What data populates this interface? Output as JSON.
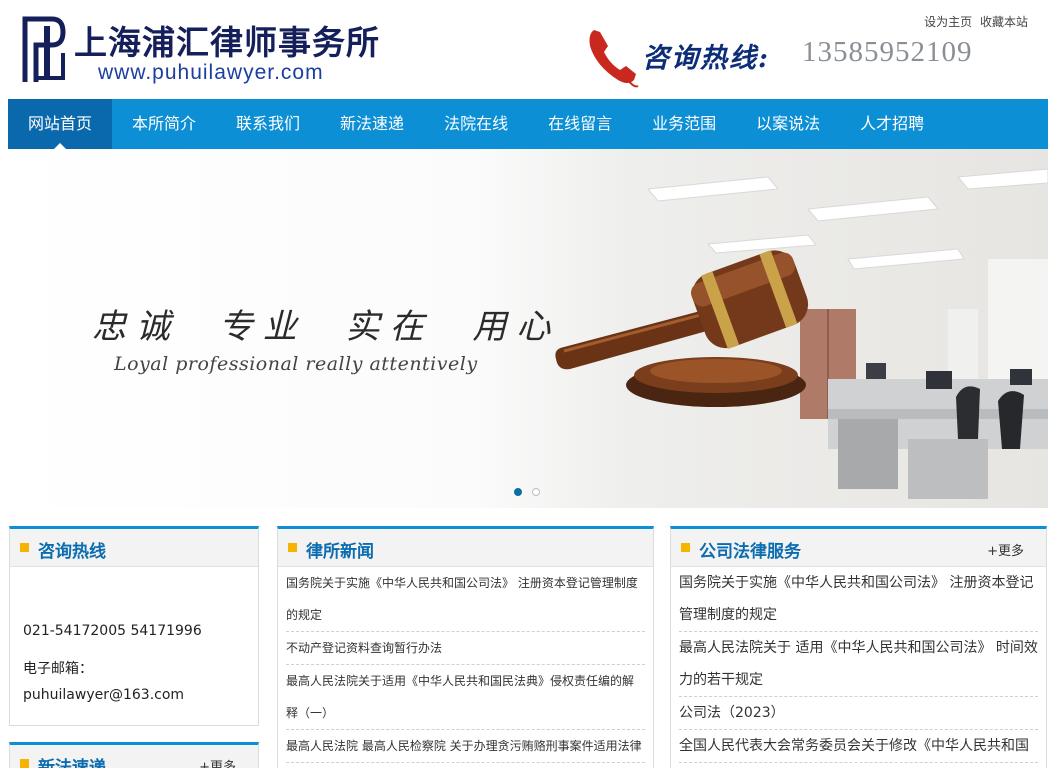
{
  "header": {
    "site_name": "上海浦汇律师事务所",
    "site_url": "www.puhuilawyer.com",
    "top_links": [
      "设为主页",
      "收藏本站"
    ],
    "hotline_label": "咨询热线:",
    "hotline_number": "13585952109"
  },
  "nav": {
    "items": [
      "网站首页",
      "本所简介",
      "联系我们",
      "新法速递",
      "法院在线",
      "在线留言",
      "业务范围",
      "以案说法",
      "人才招聘"
    ],
    "active_index": 0
  },
  "banner": {
    "slogan_cn": "忠诚 专业 实在 用心",
    "slogan_en": "Loyal professional really attentively",
    "slide_count": 2,
    "active_slide": 0
  },
  "consult": {
    "title": "咨询热线",
    "phone": "021-54172005 54171996",
    "email_label": "电子邮箱：",
    "email": "puhuilawyer@163.com"
  },
  "new_law": {
    "title": "新法速递",
    "more": "+更多"
  },
  "news": {
    "title": "律所新闻",
    "items": [
      "国务院关于实施《中华人民共和国公司法》 注册资本登记管理制度的规定",
      "不动产登记资料查询暂行办法",
      "最高人民法院关于适用《中华人民共和国民法典》侵权责任编的解释（一）",
      "最高人民法院 最高人民检察院 关于办理贪污贿赂刑事案件适用法律"
    ]
  },
  "corporate": {
    "title": "公司法律服务",
    "more": "+更多",
    "items": [
      "国务院关于实施《中华人民共和国公司法》 注册资本登记管理制度的规定",
      "最高人民法院关于 适用《中华人民共和国公司法》 时间效力的若干规定",
      "公司法（2023）",
      "全国人民代表大会常务委员会关于修改《中华人民共和国"
    ]
  },
  "colors": {
    "nav_bg": "#0c8fd4",
    "nav_active": "#0a68ac",
    "title_blue": "#0c6cb0",
    "accent_square": "#f6b400"
  },
  "icons": {
    "logo": "law-firm-logo-icon",
    "phone": "phone-handset-icon",
    "gavel": "gavel-icon"
  }
}
